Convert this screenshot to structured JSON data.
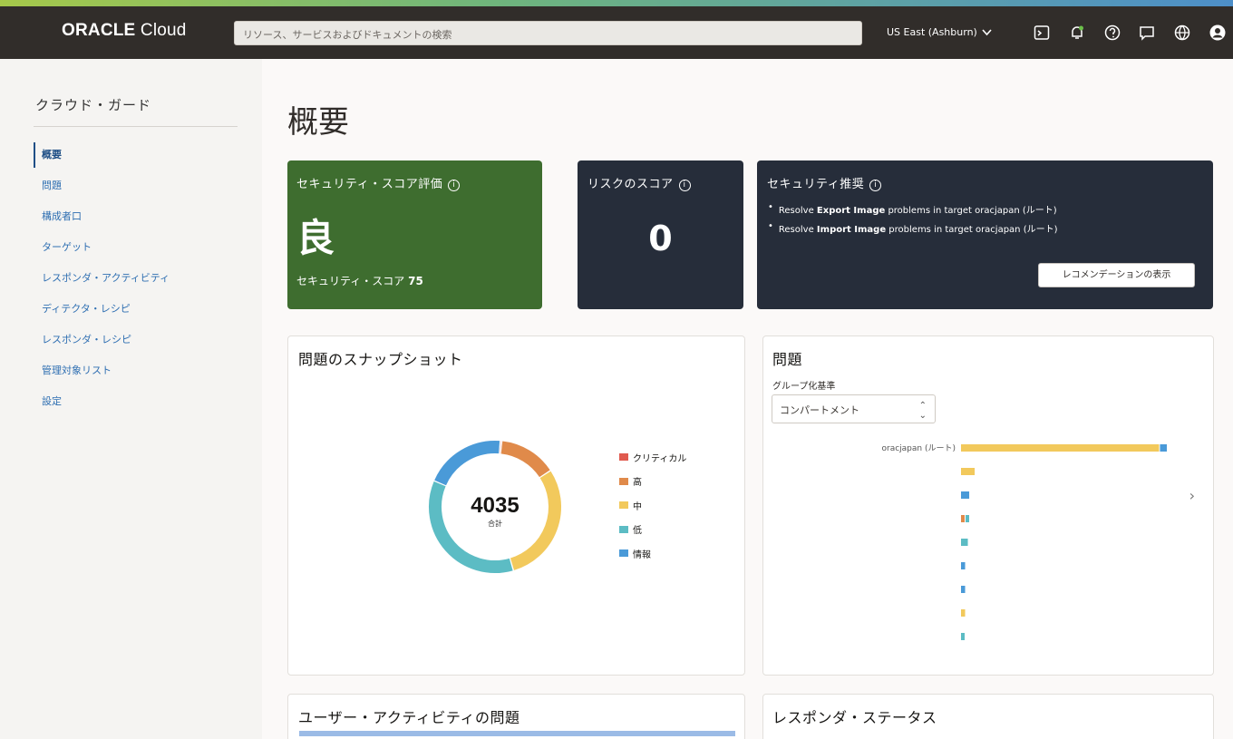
{
  "header": {
    "brand_strong": "ORACLE",
    "brand_light": " Cloud",
    "search_placeholder": "リソース、サービスおよびドキュメントの検索",
    "region": "US East (Ashburn)",
    "icons": [
      "cloud-shell-icon",
      "bell-icon",
      "help-icon",
      "chat-icon",
      "globe-icon",
      "profile-icon"
    ]
  },
  "sidebar": {
    "title": "クラウド・ガード",
    "items": [
      {
        "label": "概要",
        "active": true
      },
      {
        "label": "問題"
      },
      {
        "label": "構成者口"
      },
      {
        "label": "ターゲット"
      },
      {
        "label": "レスポンダ・アクティビティ"
      },
      {
        "label": "ディテクタ・レシピ"
      },
      {
        "label": "レスポンダ・レシピ"
      },
      {
        "label": "管理対象リスト"
      },
      {
        "label": "設定"
      }
    ]
  },
  "main": {
    "title": "概要",
    "security_score": {
      "heading": "セキュリティ・スコア評価",
      "grade": "良",
      "score_label": "セキュリティ・スコア",
      "score_value": "75",
      "color": "#3e6d2f"
    },
    "risk_score": {
      "heading": "リスクのスコア",
      "value": "0"
    },
    "recommendations": {
      "heading": "セキュリティ推奨",
      "items": [
        {
          "pre": "Resolve ",
          "bold": "Export Image",
          "post": " problems in target oracjapan (ルート)"
        },
        {
          "pre": "Resolve ",
          "bold": "Import Image",
          "post": " problems in target oracjapan (ルート)"
        }
      ],
      "button": "レコメンデーションの表示"
    },
    "snapshot": {
      "heading": "問題のスナップショット",
      "total": "4035",
      "total_label": "合計",
      "legend": [
        {
          "label": "クリティカル",
          "color": "#e05a4f"
        },
        {
          "label": "高",
          "color": "#e08a4a"
        },
        {
          "label": "中",
          "color": "#f2c95c"
        },
        {
          "label": "低",
          "color": "#5cbcc4"
        },
        {
          "label": "情報",
          "color": "#4a9ad8"
        }
      ]
    },
    "problems": {
      "heading": "問題",
      "group_label": "グループ化基準",
      "group_value": "コンパートメント",
      "categories": [
        "oracjapan (ルート)",
        "",
        "",
        "",
        "",
        "",
        "",
        "",
        ""
      ]
    },
    "user_activity": {
      "heading": "ユーザー・アクティビティの問題"
    },
    "responder_status": {
      "heading": "レスポンダ・ステータス"
    }
  },
  "chart_data": [
    {
      "type": "pie",
      "title": "問題のスナップショット",
      "series": [
        {
          "name": "クリティカル",
          "value": 15,
          "color": "#e05a4f"
        },
        {
          "name": "高",
          "value": 570,
          "color": "#e08a4a"
        },
        {
          "name": "中",
          "value": 1200,
          "color": "#f2c95c"
        },
        {
          "name": "低",
          "value": 1450,
          "color": "#5cbcc4"
        },
        {
          "name": "情報",
          "value": 800,
          "color": "#4a9ad8"
        }
      ],
      "total": 4035
    },
    {
      "type": "bar",
      "title": "問題",
      "categories": [
        "oracjapan (ルート)",
        "",
        "",
        "",
        "",
        "",
        "",
        "",
        ""
      ],
      "series": [
        {
          "name": "高",
          "color": "#e08a4a",
          "values": [
            0,
            0,
            0,
            3,
            0,
            0,
            0,
            0,
            0
          ]
        },
        {
          "name": "中",
          "color": "#f2c95c",
          "values": [
            2900,
            200,
            0,
            0,
            0,
            0,
            0,
            60,
            0
          ]
        },
        {
          "name": "低",
          "color": "#5cbcc4",
          "values": [
            0,
            0,
            0,
            50,
            100,
            0,
            0,
            0,
            40
          ]
        },
        {
          "name": "情報",
          "color": "#4a9ad8",
          "values": [
            100,
            0,
            120,
            0,
            0,
            60,
            60,
            0,
            0
          ]
        }
      ]
    }
  ]
}
